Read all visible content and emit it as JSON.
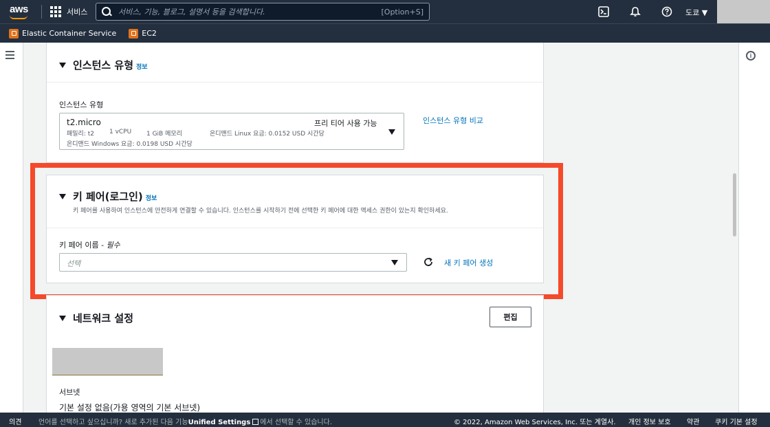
{
  "topbar": {
    "logo_text": "aws",
    "services_label": "서비스",
    "search_placeholder": "서비스, 기능, 블로그, 설명서 등을 검색합니다.",
    "search_shortcut": "[Option+S]",
    "region_label": "도쿄",
    "icons": [
      "cloudshell-icon",
      "notifications-bell-icon",
      "help-icon"
    ]
  },
  "favorites": [
    {
      "label": "Elastic Container Service",
      "icon": "ecs-icon"
    },
    {
      "label": "EC2",
      "icon": "ec2-icon"
    }
  ],
  "instance_type": {
    "section_title": "인스턴스 유형",
    "info_link": "정보",
    "field_label": "인스턴스 유형",
    "selected_value": "t2.micro",
    "free_tier": "프리 티어 사용 가능",
    "family": "패밀리: t2",
    "vcpu": "1 vCPU",
    "memory": "1 GiB 메모리",
    "linux_price": "온디맨드 Linux 요금: 0.0152 USD 시간당",
    "windows_price": "온디맨드 Windows 요금: 0.0198 USD 시간당",
    "compare_link": "인스턴스 유형 비교"
  },
  "key_pair": {
    "section_title": "키 페어(로그인)",
    "info_link": "정보",
    "description": "키 페어를 사용하여 인스턴스에 안전하게 연결할 수 있습니다. 인스턴스를 시작하기 전에 선택한 키 페어에 대한 액세스 권한이 있는지 확인하세요.",
    "field_label": "키 페어 이름 - ",
    "required_label": "필수",
    "select_placeholder": "선택",
    "create_link": "새 키 페어 생성",
    "highlight_color": "#f44a2b"
  },
  "network": {
    "section_title": "네트워크 설정",
    "edit_button": "편집",
    "subnet_label": "서브넷",
    "subnet_value": "기본 설정 없음(가용 영역의 기본 서브넷)"
  },
  "footer": {
    "feedback": "의견",
    "language_notice": "언어를 선택하고 싶으십니까? 새로 추가된 다음 기능",
    "unified_settings": "Unified Settings",
    "language_notice_tail": "에서 선택할 수 있습니다.",
    "copyright": "© 2022, Amazon Web Services, Inc. 또는 계열사.",
    "privacy": "개인 정보 보호",
    "terms": "약관",
    "cookies": "쿠키 기본 설정"
  }
}
